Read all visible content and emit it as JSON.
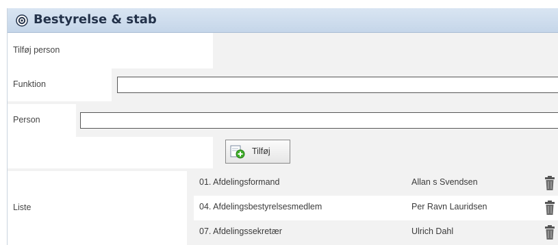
{
  "header": {
    "title": "Bestyrelse & stab",
    "icon": "gear-icon"
  },
  "add_person": {
    "heading": "Tilføj person"
  },
  "form": {
    "funktion_label": "Funktion",
    "funktion_value": "",
    "person_label": "Person",
    "person_value": "",
    "add_button_label": "Tilføj",
    "add_button_icon": "add-icon"
  },
  "liste": {
    "label": "Liste",
    "rows": [
      {
        "function": "01. Afdelingsformand",
        "person": "Allan s Svendsen"
      },
      {
        "function": "04. Afdelingsbestyrelsesmedlem",
        "person": "Per Ravn Lauridsen"
      },
      {
        "function": "07. Afdelingssekretær",
        "person": "Ulrich Dahl"
      }
    ],
    "delete_icon": "trash-icon"
  },
  "colors": {
    "header_bg": "#c5d6e9",
    "header_text": "#23324a",
    "panel_bg": "#f2f2f2"
  }
}
